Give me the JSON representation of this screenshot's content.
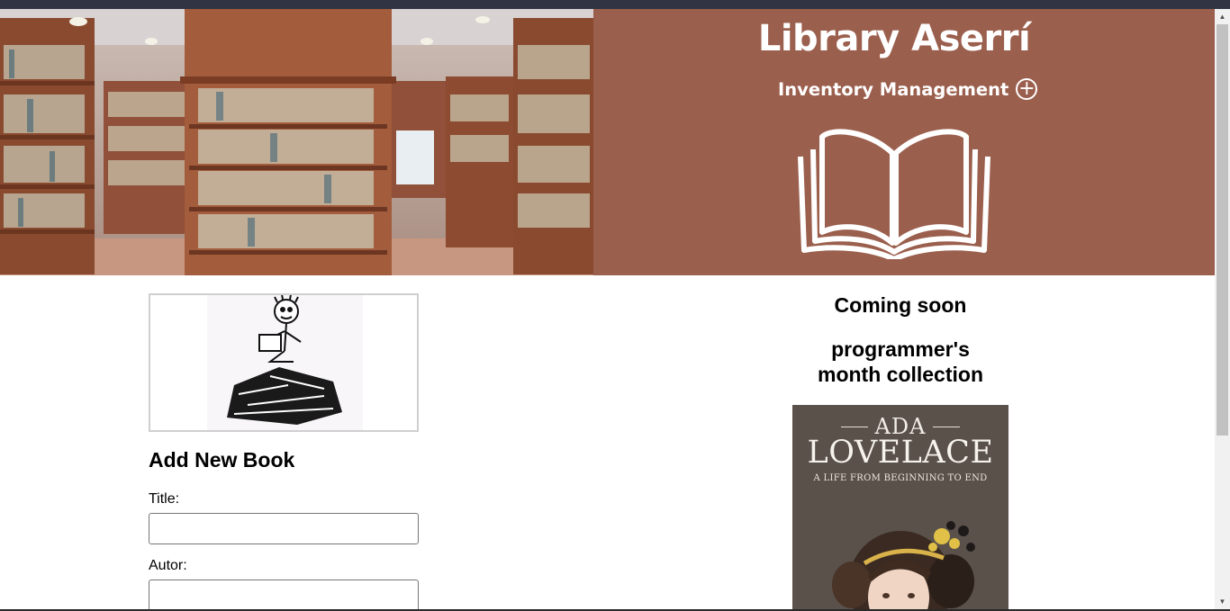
{
  "header": {
    "title": "Library Aserrí",
    "subtitle": "Inventory Management",
    "add_symbol": "+",
    "brand_color": "#9b5f4d"
  },
  "icons": {
    "add": "plus-circle-icon",
    "logo": "open-book-icon"
  },
  "form": {
    "heading": "Add New Book",
    "fields": [
      {
        "label": "Title:",
        "value": "",
        "placeholder": ""
      },
      {
        "label": "Autor:",
        "value": "",
        "placeholder": ""
      }
    ]
  },
  "promo": {
    "coming_soon": "Coming soon",
    "collection_line1": "programmer's",
    "collection_line2": "month collection",
    "cover": {
      "top_name": "Ada",
      "main_name": "Lovelace",
      "subtitle": "A Life From Beginning to End"
    }
  }
}
